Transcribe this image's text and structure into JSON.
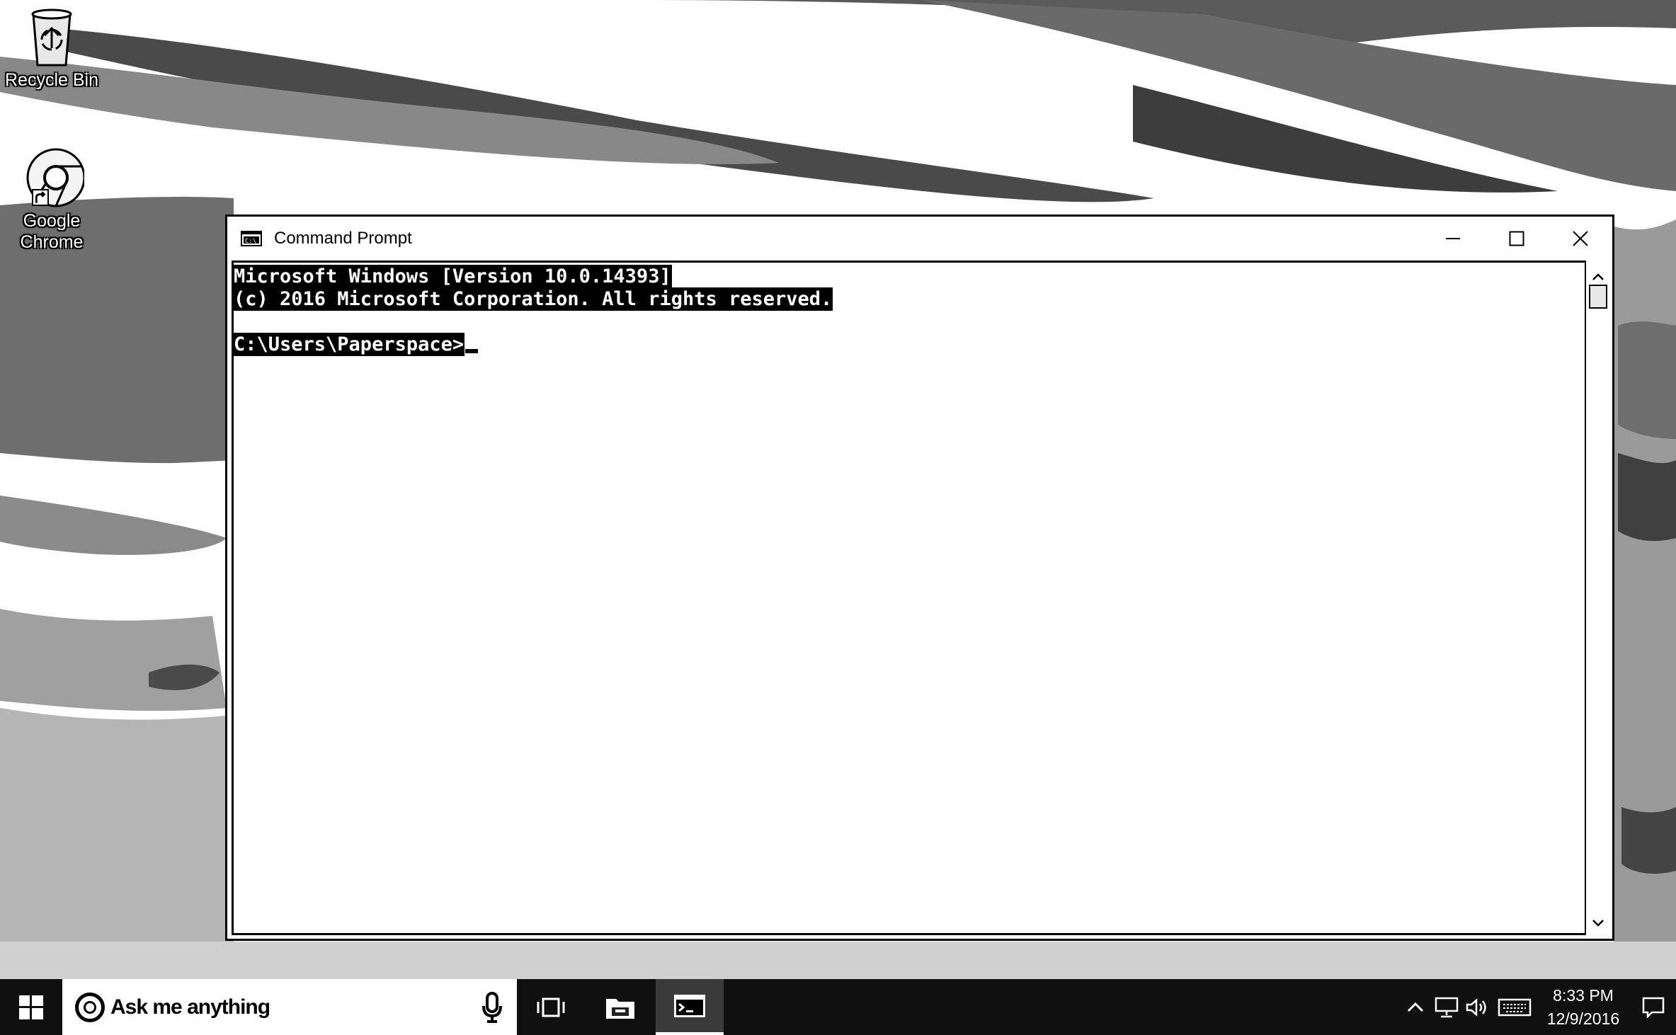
{
  "desktop": {
    "icons": [
      {
        "label": "Recycle Bin"
      },
      {
        "label": "Google Chrome"
      }
    ]
  },
  "window": {
    "title": "Command Prompt",
    "title_icon": "console-icon",
    "controls": {
      "minimize": "minimize-icon",
      "maximize": "maximize-icon",
      "close": "close-icon"
    }
  },
  "console": {
    "lines": [
      "Microsoft Windows [Version 10.0.14393]",
      "(c) 2016 Microsoft Corporation. All rights reserved.",
      "",
      "C:\\Users\\Paperspace>"
    ]
  },
  "taskbar": {
    "search_placeholder": "Ask me anything",
    "pinned": [
      "start-icon",
      "task-view-icon",
      "file-explorer-icon",
      "command-prompt-icon"
    ],
    "tray_icons": [
      "chevron-up-icon",
      "network-icon",
      "volume-icon",
      "keyboard-icon"
    ],
    "clock": {
      "time": "8:33 PM",
      "date": "12/9/2016"
    }
  },
  "colors": {
    "taskbar": "#101010",
    "window_border": "#000000",
    "console_bg": "#ffffff"
  }
}
